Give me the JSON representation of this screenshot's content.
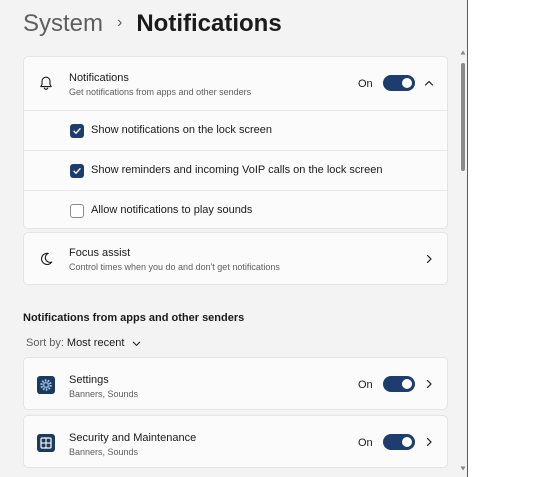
{
  "breadcrumb": {
    "parent": "System",
    "separator": "›",
    "current": "Notifications"
  },
  "notifications_card": {
    "title": "Notifications",
    "subtitle": "Get notifications from apps and other senders",
    "state": "On",
    "options": [
      {
        "label": "Show notifications on the lock screen",
        "checked": true
      },
      {
        "label": "Show reminders and incoming VoIP calls on the lock screen",
        "checked": true
      },
      {
        "label": "Allow notifications to play sounds",
        "checked": false
      }
    ]
  },
  "focus_assist": {
    "title": "Focus assist",
    "subtitle": "Control times when you do and don't get notifications"
  },
  "apps_section": {
    "heading": "Notifications from apps and other senders",
    "sort_label": "Sort by:",
    "sort_value": "Most recent",
    "apps": [
      {
        "name": "Settings",
        "detail": "Banners, Sounds",
        "state": "On",
        "icon": "gear-icon"
      },
      {
        "name": "Security and Maintenance",
        "detail": "Banners, Sounds",
        "state": "On",
        "icon": "security-maintenance-icon"
      }
    ]
  },
  "colors": {
    "accent": "#1c3d6e",
    "background": "#f3f3f3",
    "card": "#fbfbfb"
  }
}
